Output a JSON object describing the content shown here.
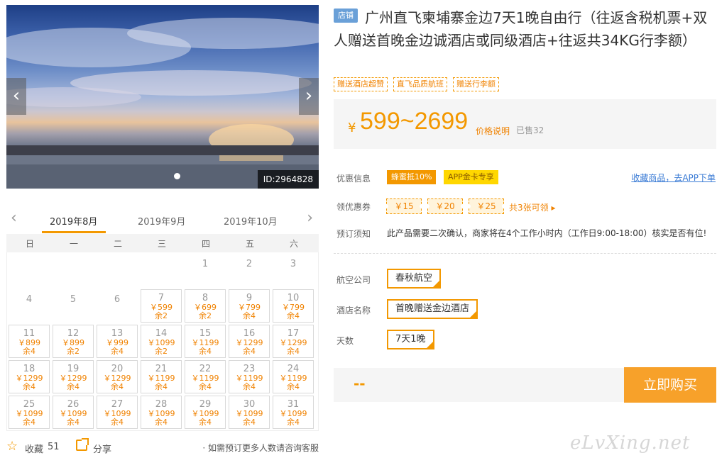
{
  "gallery": {
    "image_id": "ID:2964828",
    "prev_arrow": "‹",
    "next_arrow": "›",
    "active_slide": 1
  },
  "calendar": {
    "prev_arrow": "‹",
    "next_arrow": "›",
    "months": [
      "2019年8月",
      "2019年9月",
      "2019年10月"
    ],
    "active_month": "2019年8月",
    "weekdays": [
      "日",
      "一",
      "二",
      "三",
      "四",
      "五",
      "六"
    ],
    "blank_days": [
      "1",
      "2",
      "3",
      "4",
      "5",
      "6"
    ],
    "days": [
      {
        "day": "7",
        "price": "￥599",
        "left": "余2"
      },
      {
        "day": "8",
        "price": "￥699",
        "left": "余2"
      },
      {
        "day": "9",
        "price": "￥799",
        "left": "余4"
      },
      {
        "day": "10",
        "price": "￥799",
        "left": "余4"
      },
      {
        "day": "11",
        "price": "￥899",
        "left": "余4"
      },
      {
        "day": "12",
        "price": "￥899",
        "left": "余2"
      },
      {
        "day": "13",
        "price": "￥999",
        "left": "余4"
      },
      {
        "day": "14",
        "price": "￥1099",
        "left": "余2"
      },
      {
        "day": "15",
        "price": "￥1199",
        "left": "余4"
      },
      {
        "day": "16",
        "price": "￥1299",
        "left": "余4"
      },
      {
        "day": "17",
        "price": "￥1299",
        "left": "余4"
      },
      {
        "day": "18",
        "price": "￥1299",
        "left": "余4"
      },
      {
        "day": "19",
        "price": "￥1299",
        "left": "余4"
      },
      {
        "day": "20",
        "price": "￥1299",
        "left": "余4"
      },
      {
        "day": "21",
        "price": "￥1199",
        "left": "余4"
      },
      {
        "day": "22",
        "price": "￥1199",
        "left": "余4"
      },
      {
        "day": "23",
        "price": "￥1199",
        "left": "余4"
      },
      {
        "day": "24",
        "price": "￥1199",
        "left": "余4"
      },
      {
        "day": "25",
        "price": "￥1099",
        "left": "余4"
      },
      {
        "day": "26",
        "price": "￥1099",
        "left": "余4"
      },
      {
        "day": "27",
        "price": "￥1099",
        "left": "余4"
      },
      {
        "day": "28",
        "price": "￥1099",
        "left": "余4"
      },
      {
        "day": "29",
        "price": "￥1099",
        "left": "余4"
      },
      {
        "day": "30",
        "price": "￥1099",
        "left": "余4"
      },
      {
        "day": "31",
        "price": "￥1099",
        "left": "余4"
      }
    ]
  },
  "actions": {
    "favorite_label": "收藏",
    "favorite_count": "51",
    "share_label": "分享",
    "consult_text": "· 如需预订更多人数请咨询客服"
  },
  "product": {
    "badge": "店铺",
    "title": "广州直飞柬埔寨金边7天1晚自由行（往返含税机票+双人赠送首晚金边诚酒店或同级酒店+往返共34KG行李额）",
    "tags": [
      "赠送酒店超赞",
      "直飞品质航班",
      "赠送行李额"
    ],
    "yen": "¥",
    "price_range": "599~2699",
    "price_note": "价格说明",
    "sold": "已售32"
  },
  "offers": {
    "promo_label": "优惠信息",
    "promo_tags": [
      "蜂蜜抵10%",
      "APP金卡专享"
    ],
    "favorite_link": "收藏商品，去APP下单",
    "coupon_label": "领优惠券",
    "coupons": [
      "￥15",
      "￥20",
      "￥25"
    ],
    "coupon_more": "共3张可领 ▸",
    "booking_label": "预订须知",
    "booking_text": "此产品需要二次确认，商家将在4个工作小时内（工作日9:00-18:00）核实是否有位!"
  },
  "options": {
    "airline_label": "航空公司",
    "airline_value": "春秋航空",
    "hotel_label": "酒店名称",
    "hotel_value": "首晚赠送金边酒店",
    "days_label": "天数",
    "days_value": "7天1晚"
  },
  "purchase": {
    "quantity": "--",
    "buy_label": "立即购买"
  },
  "watermark": "eLvXing.net",
  "colors": {
    "accent": "#f39800",
    "button": "#f7a12a",
    "link": "#3a7bd5"
  }
}
